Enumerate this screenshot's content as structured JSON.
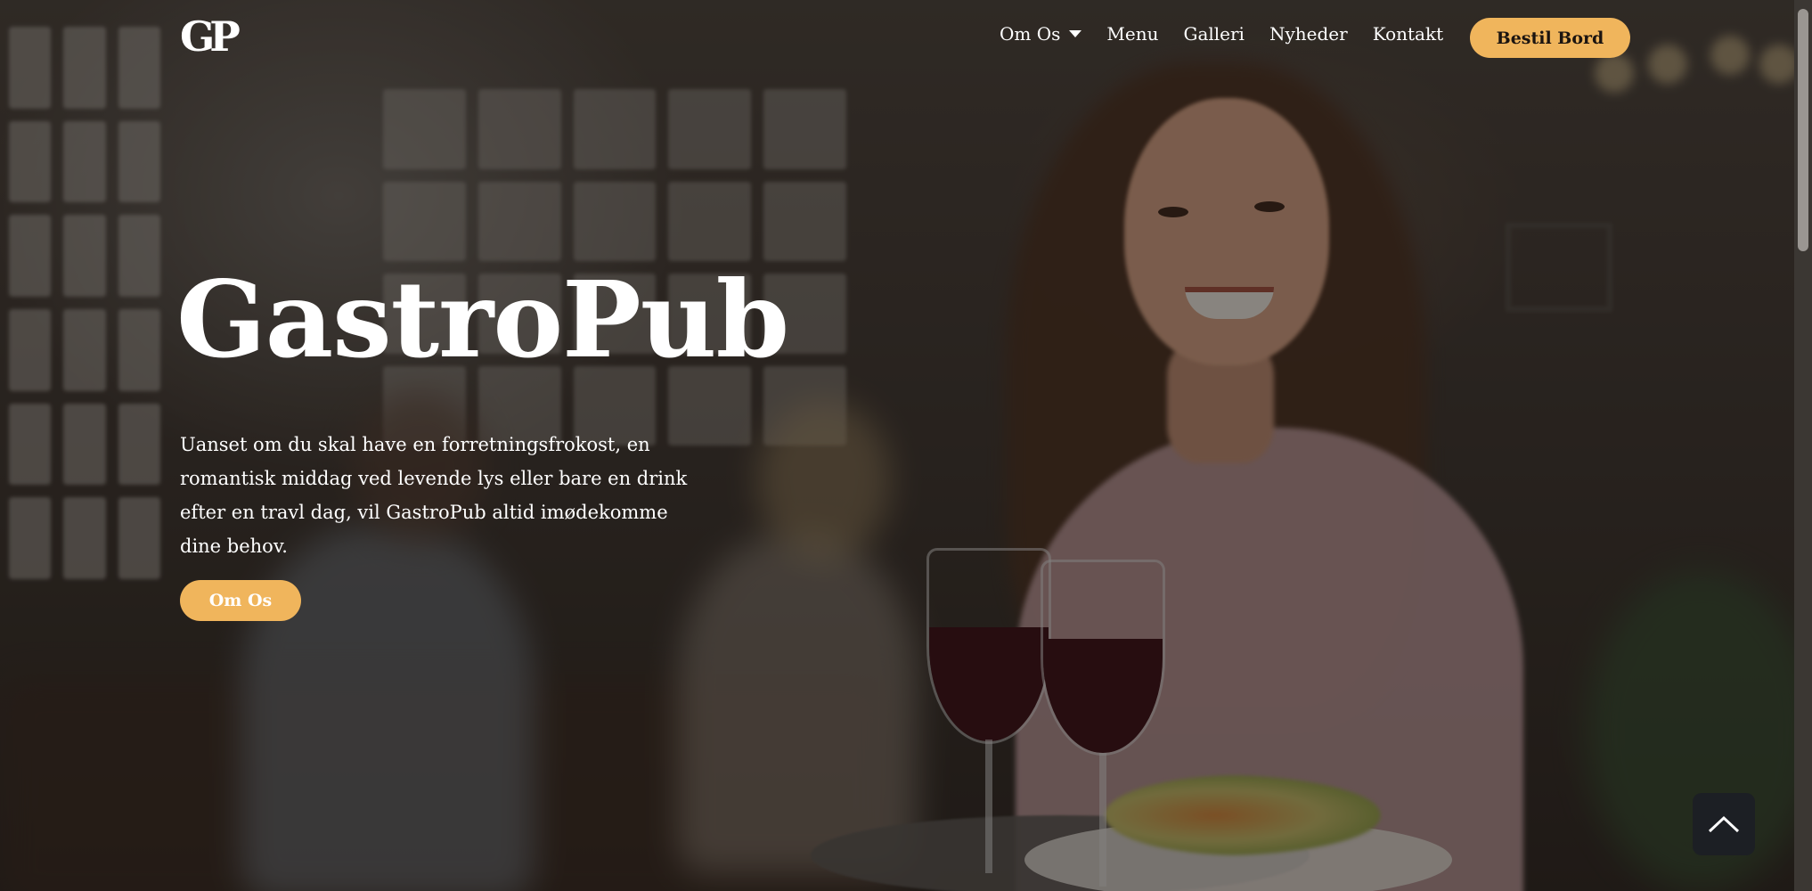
{
  "brand": {
    "logo_text": "GP"
  },
  "nav": {
    "items": [
      {
        "label": "Om Os",
        "has_dropdown": true
      },
      {
        "label": "Menu",
        "has_dropdown": false
      },
      {
        "label": "Galleri",
        "has_dropdown": false
      },
      {
        "label": "Nyheder",
        "has_dropdown": false
      },
      {
        "label": "Kontakt",
        "has_dropdown": false
      }
    ],
    "cta_label": "Bestil Bord"
  },
  "hero": {
    "title": "GastroPub",
    "description": "Uanset om du skal have en forretningsfrokost, en romantisk middag ved levende lys eller bare en drink efter en travl dag, vil GastroPub altid imødekomme dine behov.",
    "button_label": "Om Os"
  },
  "icons": {
    "dropdown": "chevron-down-icon",
    "back_to_top": "chevron-up-icon"
  },
  "colors": {
    "accent": "#f0b55c",
    "overlay": "#120e0c",
    "back_to_top_bg": "#1c1f24"
  }
}
